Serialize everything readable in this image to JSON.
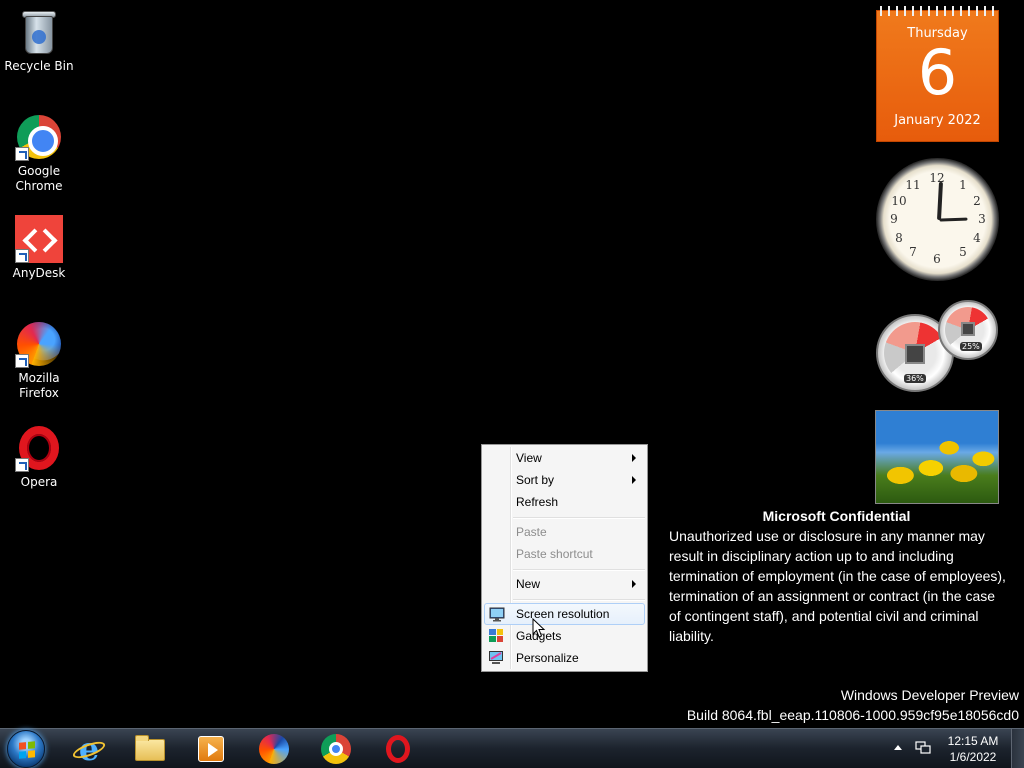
{
  "desktop": {
    "icons": [
      {
        "label": "Recycle Bin"
      },
      {
        "label": "Google\nChrome",
        "line1": "Google",
        "line2": "Chrome"
      },
      {
        "label": "AnyDesk"
      },
      {
        "label": "Mozilla Firefox",
        "line1": "Mozilla",
        "line2": "Firefox"
      },
      {
        "label": "Opera"
      }
    ]
  },
  "gadgets": {
    "calendar": {
      "weekday": "Thursday",
      "day": "6",
      "month_year": "January 2022"
    },
    "clock": {
      "numbers": [
        "12",
        "1",
        "2",
        "3",
        "4",
        "5",
        "6",
        "7",
        "8",
        "9",
        "10",
        "11"
      ]
    },
    "cpu_meter": {
      "cpu": "36%",
      "memory": "25%"
    }
  },
  "confidential": {
    "title": "Microsoft Confidential",
    "body": "Unauthorized use or disclosure in any manner may result in disciplinary action up to and including termination of employment (in the case of employees), termination of an assignment or contract (in the case of contingent staff), and potential civil and criminal liability."
  },
  "build_info": {
    "line1": "Windows Developer Preview",
    "line2": "Build 8064.fbl_eeap.110806-1000.959cf95e18056cd0"
  },
  "context_menu": {
    "items": [
      {
        "label": "View",
        "submenu": true
      },
      {
        "label": "Sort by",
        "submenu": true
      },
      {
        "label": "Refresh"
      },
      {
        "label": "Paste",
        "disabled": true
      },
      {
        "label": "Paste shortcut",
        "disabled": true
      },
      {
        "label": "New",
        "submenu": true
      },
      {
        "label": "Screen resolution",
        "icon": "display-icon"
      },
      {
        "label": "Gadgets",
        "icon": "gadgets-icon"
      },
      {
        "label": "Personalize",
        "icon": "personalize-icon"
      }
    ]
  },
  "taskbar": {
    "pinned": [
      "start-orb",
      "internet-explorer-icon",
      "file-explorer-icon",
      "media-player-icon",
      "firefox-icon",
      "chrome-icon",
      "opera-icon"
    ],
    "time": "12:15 AM",
    "date": "1/6/2022"
  },
  "colors": {
    "calendar_orange": "#e96a12",
    "taskbar_dark": "#1c232d",
    "menu_highlight": "#aecff7"
  }
}
